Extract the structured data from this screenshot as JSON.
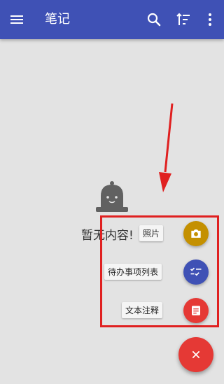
{
  "appbar": {
    "title": "笔记",
    "menu_icon": "menu-icon",
    "search_icon": "search-icon",
    "sort_icon": "sort-icon",
    "more_icon": "more-vert-icon",
    "color": "#3f51b5"
  },
  "empty_state": {
    "icon": "bell-mascot-icon",
    "text": "暂无内容!"
  },
  "fab_menu": {
    "items": [
      {
        "label": "照片",
        "icon": "camera-icon",
        "color": "#c49000"
      },
      {
        "label": "待办事项列表",
        "icon": "checklist-icon",
        "color": "#3f51b5"
      },
      {
        "label": "文本注释",
        "icon": "note-icon",
        "color": "#e53935"
      }
    ],
    "close_icon": "close-icon",
    "close_color": "#e53935"
  },
  "annotation": {
    "arrow_color": "#e02020",
    "box_color": "#e02020"
  }
}
